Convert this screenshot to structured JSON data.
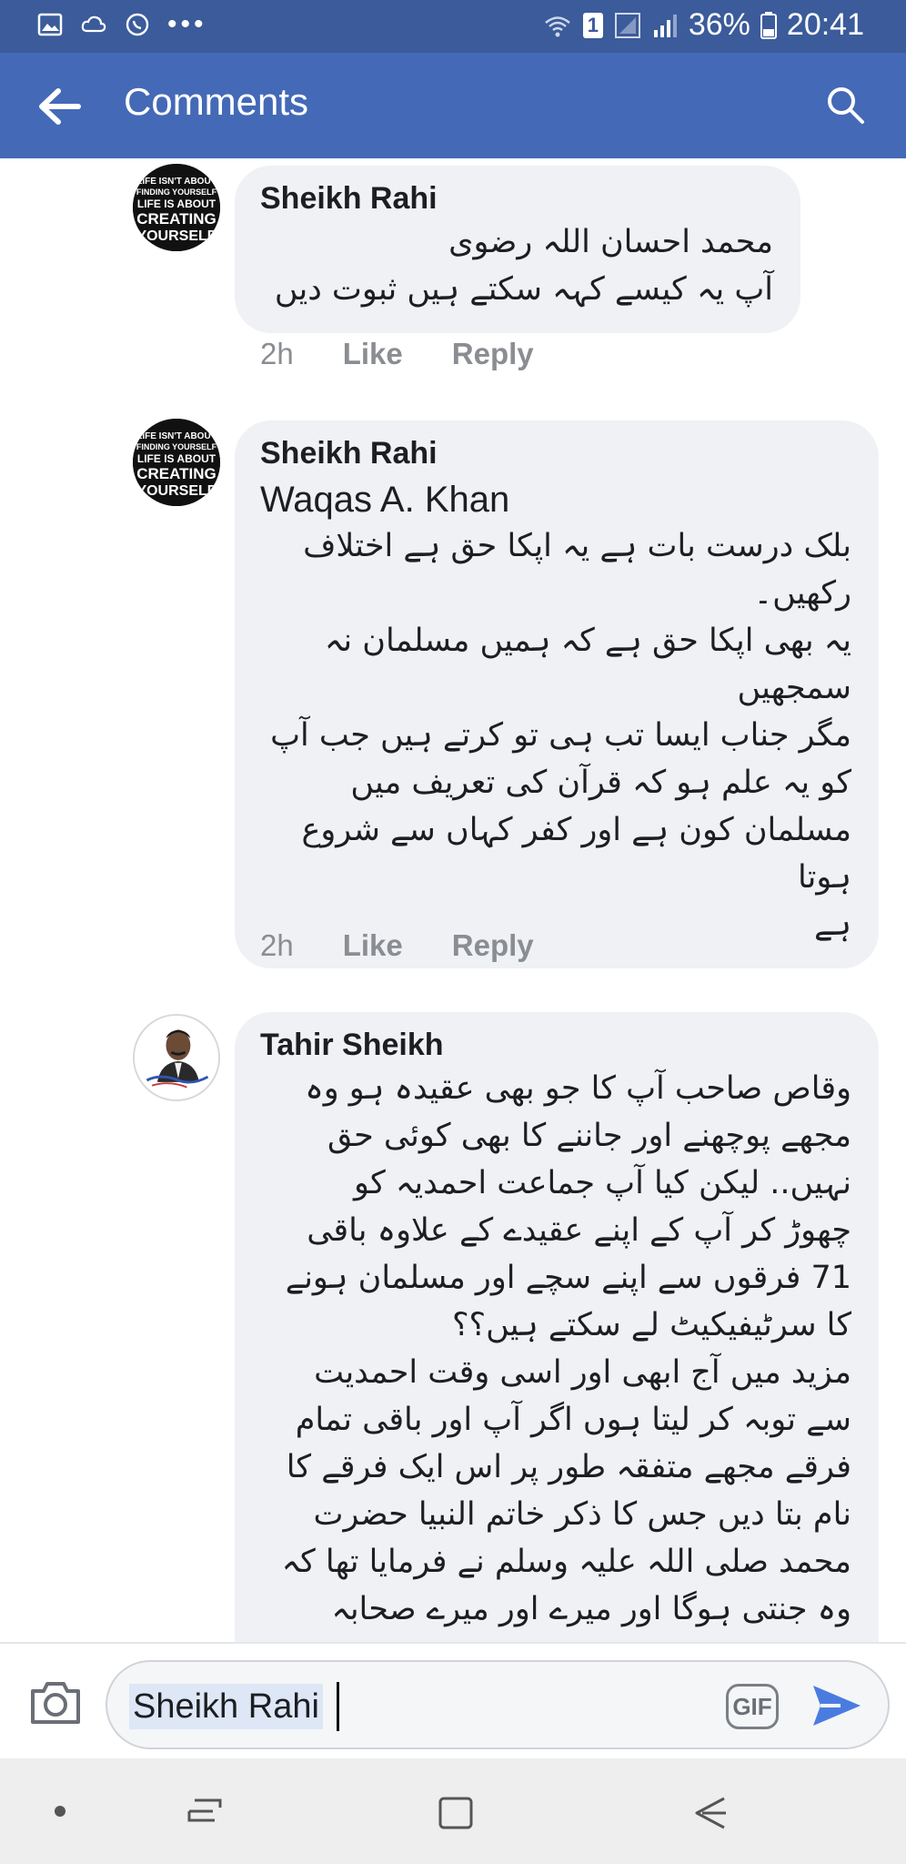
{
  "status_bar": {
    "battery": "36%",
    "time": "20:41",
    "sim_badge": "1",
    "icons": [
      "gallery-icon",
      "cloud-icon",
      "whatsapp-icon",
      "more-dots-icon",
      "wifi-icon",
      "signal-icon",
      "battery-icon"
    ]
  },
  "app_bar": {
    "title": "Comments"
  },
  "comments": [
    {
      "author": "Sheikh Rahi",
      "avatar_lines": [
        "LIFE ISN'T ABOUT",
        "FINDING YOURSELF",
        "LIFE IS ABOUT",
        "CREATING",
        "YOURSELF"
      ],
      "lines": [
        "محمد احسان اللہ رضوی",
        "آپ یہ کیسے کہہ سکتے ہیں ثبوت دیں"
      ],
      "time": "2h",
      "like": "Like",
      "reply": "Reply"
    },
    {
      "author": "Sheikh Rahi",
      "avatar_lines": [
        "LIFE ISN'T ABOUT",
        "FINDING YOURSELF",
        "LIFE IS ABOUT",
        "CREATING",
        "YOURSELF"
      ],
      "mention": "Waqas A. Khan",
      "lines": [
        "بلک درست بات ہے یہ اپکا حق ہے اختلاف",
        "رکھیں۔",
        "یہ بھی اپکا حق ہے کہ ہمیں مسلمان نہ",
        "سمجھیں",
        "مگر جناب ایسا تب ہی تو کرتے ہیں جب آپ",
        "کو یہ علم ہو کہ قرآن کی تعریف میں",
        "مسلمان کون ہے اور کفر کہاں سے شروع ہوتا",
        "ہے"
      ],
      "time": "2h",
      "like": "Like",
      "reply": "Reply"
    },
    {
      "author": "Tahir Sheikh",
      "lines": [
        "وقاص صاحب آپ کا جو بھی عقیدہ ہو وہ",
        "مجھے پوچھنے اور جاننے کا بھی کوئی حق",
        "نہیں.. لیکن کیا آپ جماعت احمدیہ کو",
        "چھوڑ کر آپ کے اپنے عقیدے کے علاوہ باقی",
        "71 فرقوں سے اپنے سچے اور مسلمان ہونے",
        "کا سرٹیفیکیٹ لے سکتے ہیں؟؟",
        "مزید میں آج ابھی اور اسی وقت احمدیت",
        "سے توبہ کر لیتا ہوں اگر آپ اور باقی تمام",
        "فرقے مجھے متفقہ طور پر اس ایک فرقے کا",
        "نام بتا دیں جس کا ذکر خاتم النبیا حضرت",
        "محمد صلی اللہ علیہ وسلم نے فرمایا تھا کہ",
        "وہ جنتی ہوگا اور میرے اور میرے صحابہ"
      ]
    }
  ],
  "composer": {
    "text": "Sheikh Rahi",
    "gif_label": "GIF"
  },
  "nav_bar": {
    "icons": [
      "dot-icon",
      "recent-apps-icon",
      "home-icon",
      "back-nav-icon"
    ]
  }
}
